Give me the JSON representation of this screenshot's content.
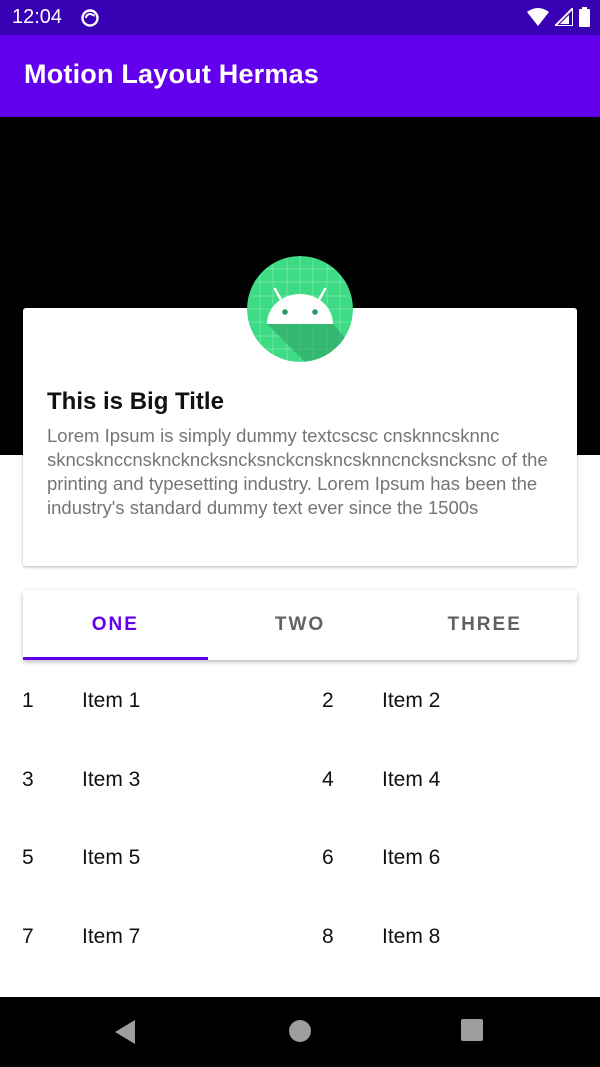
{
  "status_bar": {
    "time": "12:04",
    "icons": [
      "sync-icon",
      "wifi-icon",
      "signal-icon",
      "battery-icon"
    ]
  },
  "app_bar": {
    "title": "Motion Layout Hermas"
  },
  "card": {
    "avatar_icon": "android-icon",
    "title": "This is Big Title",
    "body": "Lorem Ipsum is simply dummy textcscsc cnsknncsknnc skncsknccnsknckncksncksnckcnskncsknncncksncksnc of the printing and typesetting industry. Lorem Ipsum has been the industry's standard dummy text ever since the 1500s"
  },
  "tabs": [
    {
      "label": "ONE",
      "selected": true
    },
    {
      "label": "TWO",
      "selected": false
    },
    {
      "label": "THREE",
      "selected": false
    }
  ],
  "items": [
    {
      "number": "1",
      "label": "Item 1"
    },
    {
      "number": "2",
      "label": "Item 2"
    },
    {
      "number": "3",
      "label": "Item 3"
    },
    {
      "number": "4",
      "label": "Item 4"
    },
    {
      "number": "5",
      "label": "Item 5"
    },
    {
      "number": "6",
      "label": "Item 6"
    },
    {
      "number": "7",
      "label": "Item 7"
    },
    {
      "number": "8",
      "label": "Item 8"
    }
  ],
  "nav_bar": {
    "icons": [
      "back-icon",
      "home-icon",
      "recents-icon"
    ]
  },
  "colors": {
    "status_bar": "#3700b3",
    "primary": "#6200ee",
    "hero_background": "#000000",
    "android_green": "#3ddc84"
  }
}
